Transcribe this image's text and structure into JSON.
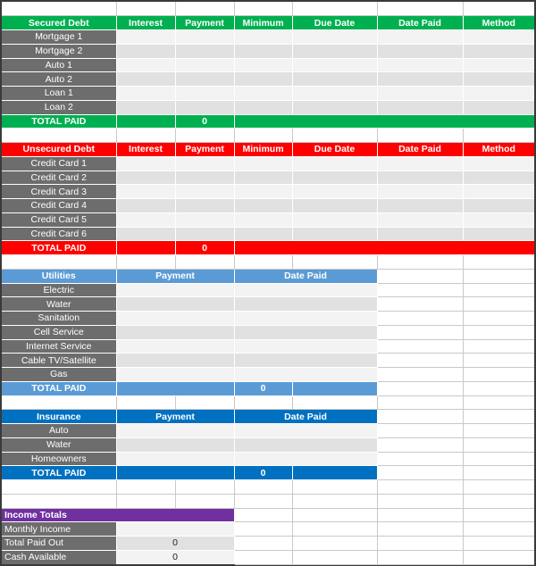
{
  "colors": {
    "secured": "#00b050",
    "unsecured": "#ff0000",
    "utilities": "#5b9bd5",
    "insurance": "#0070c0",
    "income": "#7030a0",
    "label_bg": "#6d6d6d"
  },
  "debt_columns": [
    "Interest",
    "Payment",
    "Minimum",
    "Due Date",
    "Date Paid",
    "Method"
  ],
  "secured": {
    "title": "Secured Debt",
    "items": [
      "Mortgage 1",
      "Mortgage 2",
      "Auto 1",
      "Auto 2",
      "Loan 1",
      "Loan 2"
    ],
    "total_label": "TOTAL PAID",
    "total_value": "0"
  },
  "unsecured": {
    "title": "Unsecured  Debt",
    "items": [
      "Credit Card 1",
      "Credit Card 2",
      "Credit Card 3",
      "Credit Card 4",
      "Credit Card 5",
      "Credit Card 6"
    ],
    "total_label": "TOTAL PAID",
    "total_value": "0"
  },
  "utilities": {
    "title": "Utilities",
    "columns": [
      "Payment",
      "Date Paid"
    ],
    "items": [
      "Electric",
      "Water",
      "Sanitation",
      "Cell Service",
      "Internet Service",
      "Cable TV/Satellite",
      "Gas"
    ],
    "total_label": "TOTAL PAID",
    "total_value": "0"
  },
  "insurance": {
    "title": "Insurance",
    "columns": [
      "Payment",
      "Date Paid"
    ],
    "items": [
      "Auto",
      "Water",
      "Homeowners"
    ],
    "total_label": "TOTAL PAID",
    "total_value": "0"
  },
  "income": {
    "title": "Income Totals",
    "rows": [
      {
        "label": "Monthly Income",
        "value": ""
      },
      {
        "label": "Total Paid Out",
        "value": "0"
      },
      {
        "label": "Cash Available",
        "value": "0"
      }
    ]
  }
}
